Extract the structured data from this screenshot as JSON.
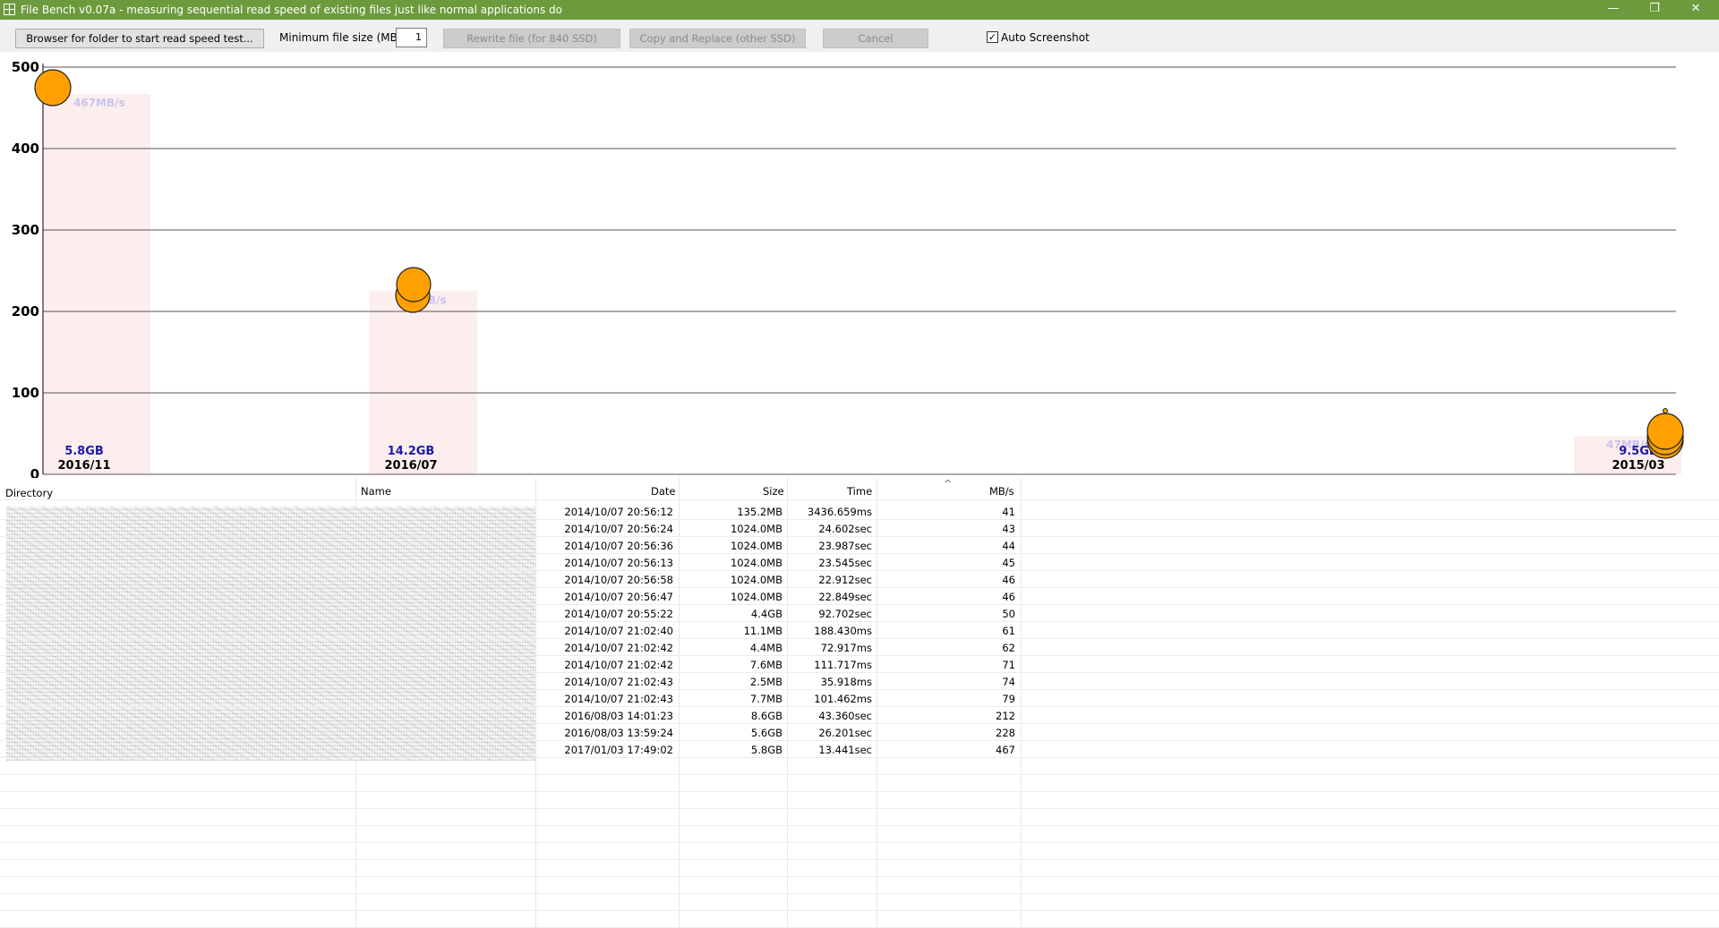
{
  "window": {
    "title": "File Bench v0.07a - measuring sequential read speed of existing files just like normal applications do",
    "minimize_glyph": "—",
    "restore_glyph": "❐",
    "close_glyph": "✕"
  },
  "toolbar": {
    "browse_label": "Browser for folder to start read speed test...",
    "min_size_label": "Minimum file size (MB):",
    "min_size_value": "1",
    "rewrite_label": "Rewrite file (for 840 SSD)",
    "copy_replace_label": "Copy and Replace (other SSD)",
    "cancel_label": "Cancel",
    "auto_screenshot_label": "Auto Screenshot",
    "auto_screenshot_checked": true
  },
  "chart_data": {
    "type": "bar",
    "ylim": [
      0,
      500
    ],
    "yticks": [
      0,
      100,
      200,
      300,
      400,
      500
    ],
    "grid": true,
    "bars": [
      {
        "date": "2016/11",
        "size": "5.8GB",
        "value": 467,
        "label": "467MB/s",
        "value_label_visible": true
      },
      {
        "date": "2016/07",
        "size": "14.2GB",
        "value": 225,
        "label": "B/s",
        "value_label_visible": true
      },
      {
        "date": "2015/03",
        "size": "9.5GB",
        "value": 47,
        "label": "47MB/s",
        "value_label_visible": true
      }
    ],
    "colors": {
      "bar_fill": "#fdeeee",
      "size_text": "#1a1aa8",
      "value_text": "#c7c3ee",
      "marker": "#ffa000",
      "grid_line": "#555555"
    }
  },
  "table": {
    "headers": {
      "directory": "Directory",
      "name": "Name",
      "date": "Date",
      "size": "Size",
      "time": "Time",
      "mbs": "MB/s"
    },
    "sort_indicator": "^",
    "rows": [
      {
        "date": "2014/10/07 20:56:12",
        "size": "135.2MB",
        "time": "3436.659ms",
        "mbs": "41"
      },
      {
        "date": "2014/10/07 20:56:24",
        "size": "1024.0MB",
        "time": "24.602sec",
        "mbs": "43"
      },
      {
        "date": "2014/10/07 20:56:36",
        "size": "1024.0MB",
        "time": "23.987sec",
        "mbs": "44"
      },
      {
        "date": "2014/10/07 20:56:13",
        "size": "1024.0MB",
        "time": "23.545sec",
        "mbs": "45"
      },
      {
        "date": "2014/10/07 20:56:58",
        "size": "1024.0MB",
        "time": "22.912sec",
        "mbs": "46"
      },
      {
        "date": "2014/10/07 20:56:47",
        "size": "1024.0MB",
        "time": "22.849sec",
        "mbs": "46"
      },
      {
        "date": "2014/10/07 20:55:22",
        "size": "4.4GB",
        "time": "92.702sec",
        "mbs": "50"
      },
      {
        "date": "2014/10/07 21:02:40",
        "size": "11.1MB",
        "time": "188.430ms",
        "mbs": "61"
      },
      {
        "date": "2014/10/07 21:02:42",
        "size": "4.4MB",
        "time": "72.917ms",
        "mbs": "62"
      },
      {
        "date": "2014/10/07 21:02:42",
        "size": "7.6MB",
        "time": "111.717ms",
        "mbs": "71"
      },
      {
        "date": "2014/10/07 21:02:43",
        "size": "2.5MB",
        "time": "35.918ms",
        "mbs": "74"
      },
      {
        "date": "2014/10/07 21:02:43",
        "size": "7.7MB",
        "time": "101.462ms",
        "mbs": "79"
      },
      {
        "date": "2016/08/03 14:01:23",
        "size": "8.6GB",
        "time": "43.360sec",
        "mbs": "212"
      },
      {
        "date": "2016/08/03 13:59:24",
        "size": "5.6GB",
        "time": "26.201sec",
        "mbs": "228"
      },
      {
        "date": "2017/01/03 17:49:02",
        "size": "5.8GB",
        "time": "13.441sec",
        "mbs": "467"
      }
    ]
  }
}
